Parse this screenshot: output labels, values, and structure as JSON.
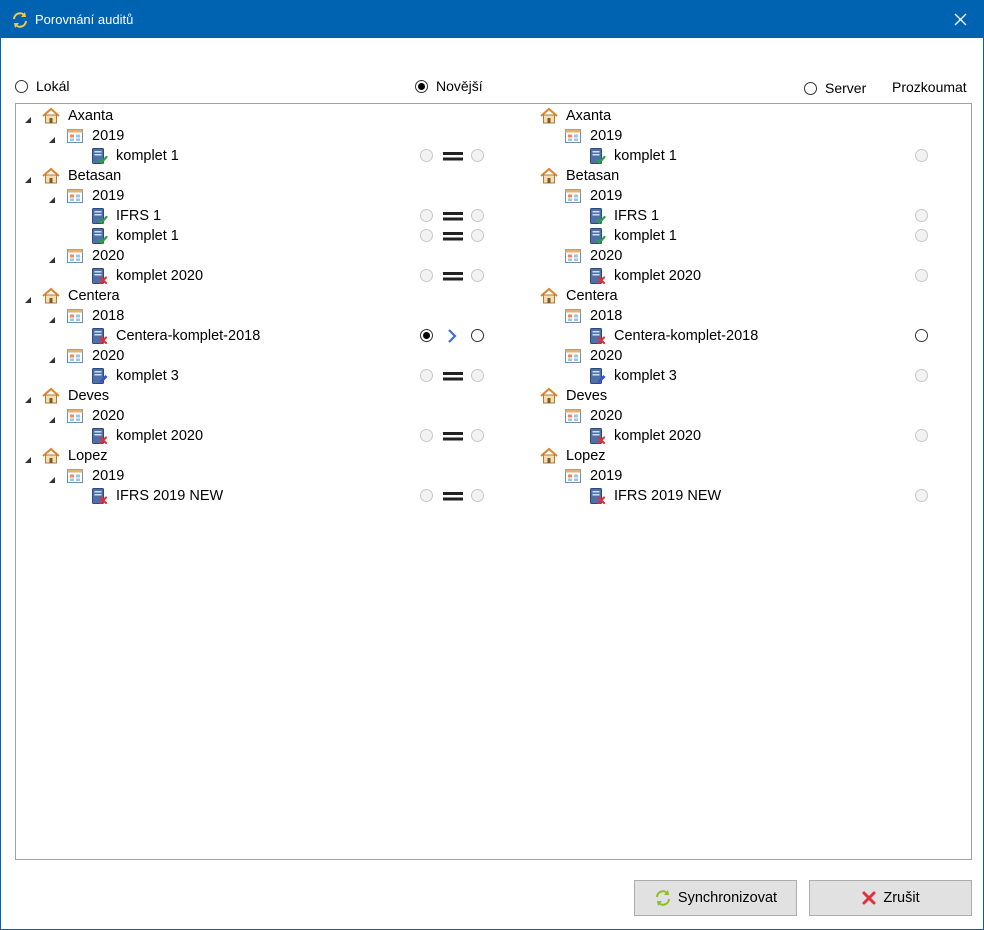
{
  "window": {
    "title": "Porovnání auditů"
  },
  "options": {
    "local": {
      "label": "Lokál",
      "selected": false
    },
    "newer": {
      "label": "Novější",
      "selected": true
    },
    "server": {
      "label": "Server",
      "selected": false
    },
    "explore_header": "Prozkoumat"
  },
  "tree": [
    {
      "level": 0,
      "type": "client",
      "label": "Axanta",
      "expanded": true
    },
    {
      "level": 1,
      "type": "year",
      "label": "2019",
      "expanded": true
    },
    {
      "level": 2,
      "type": "audit",
      "label": "komplet 1",
      "status": "check",
      "compare": "equal",
      "explore_enabled": false
    },
    {
      "level": 0,
      "type": "client",
      "label": "Betasan",
      "expanded": true
    },
    {
      "level": 1,
      "type": "year",
      "label": "2019",
      "expanded": true
    },
    {
      "level": 2,
      "type": "audit",
      "label": "IFRS 1",
      "status": "check",
      "compare": "equal",
      "explore_enabled": false
    },
    {
      "level": 2,
      "type": "audit",
      "label": "komplet 1",
      "status": "check",
      "compare": "equal",
      "explore_enabled": false
    },
    {
      "level": 1,
      "type": "year",
      "label": "2020",
      "expanded": true
    },
    {
      "level": 2,
      "type": "audit",
      "label": "komplet 2020",
      "status": "cross",
      "compare": "equal",
      "explore_enabled": false
    },
    {
      "level": 0,
      "type": "client",
      "label": "Centera",
      "expanded": true
    },
    {
      "level": 1,
      "type": "year",
      "label": "2018",
      "expanded": true
    },
    {
      "level": 2,
      "type": "audit",
      "label": "Centera-komplet-2018",
      "status": "cross",
      "compare": "newer_local",
      "explore_enabled": true
    },
    {
      "level": 1,
      "type": "year",
      "label": "2020",
      "expanded": true
    },
    {
      "level": 2,
      "type": "audit",
      "label": "komplet 3",
      "status": "edit",
      "compare": "equal",
      "explore_enabled": false
    },
    {
      "level": 0,
      "type": "client",
      "label": "Deves",
      "expanded": true
    },
    {
      "level": 1,
      "type": "year",
      "label": "2020",
      "expanded": true
    },
    {
      "level": 2,
      "type": "audit",
      "label": "komplet 2020",
      "status": "cross",
      "compare": "equal",
      "explore_enabled": false
    },
    {
      "level": 0,
      "type": "client",
      "label": "Lopez",
      "expanded": true
    },
    {
      "level": 1,
      "type": "year",
      "label": "2019",
      "expanded": true
    },
    {
      "level": 2,
      "type": "audit",
      "label": "IFRS 2019 NEW",
      "status": "cross",
      "compare": "equal",
      "explore_enabled": false
    }
  ],
  "buttons": {
    "sync": {
      "label": "Synchronizovat",
      "icon": "sync-icon"
    },
    "cancel": {
      "label": "Zrušit",
      "icon": "cancel-x-icon"
    }
  },
  "colors": {
    "titlebar": "#0063b1",
    "accent_arrow": "#3f6ee0",
    "check": "#2ea043",
    "cross": "#e0313b",
    "edit": "#3a4fd1",
    "sync_icon": "#8cbf26"
  }
}
